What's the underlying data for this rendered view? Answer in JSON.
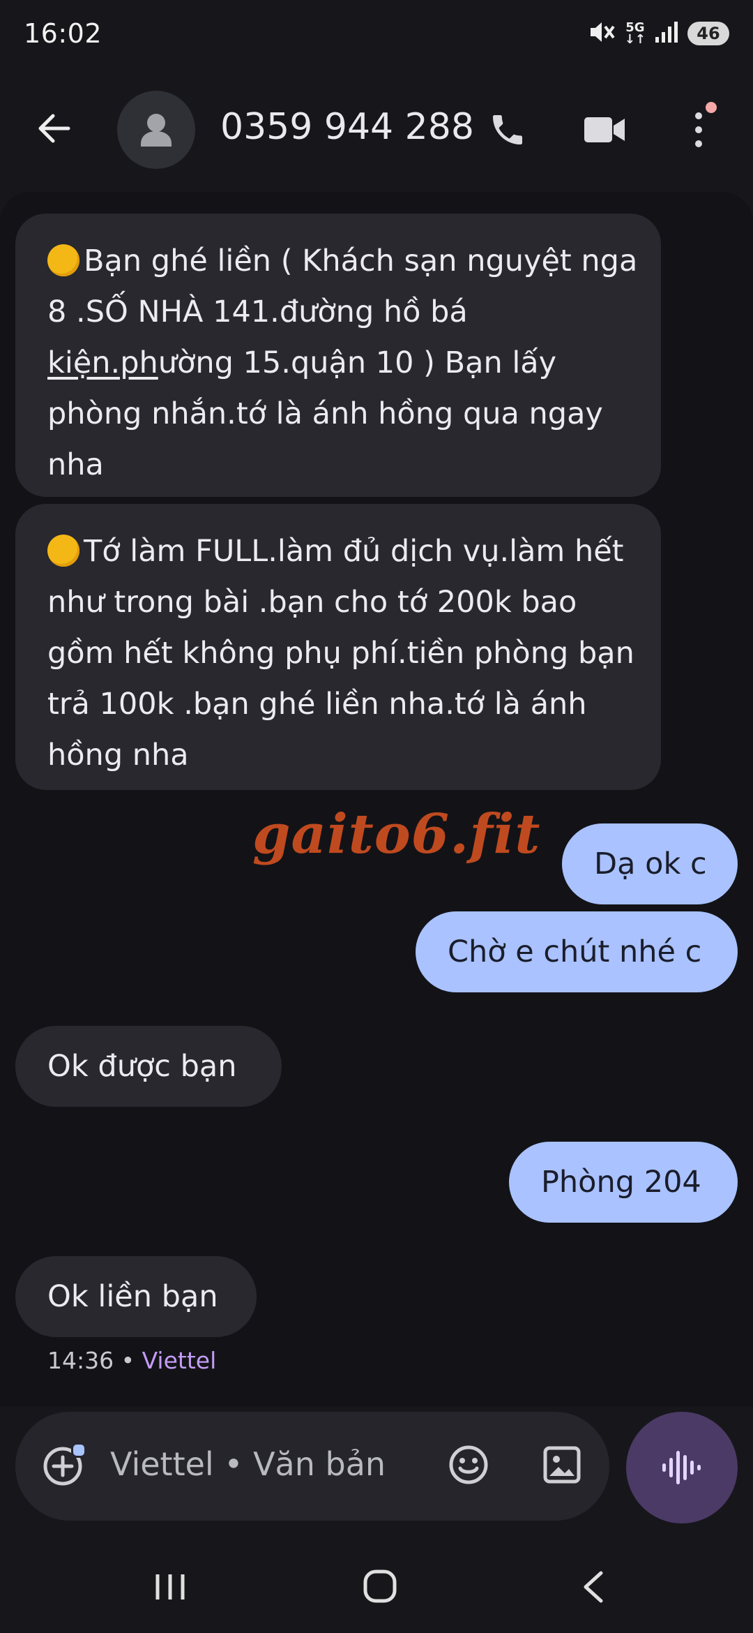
{
  "status_bar": {
    "time": "16:02",
    "network": "5G",
    "battery": "46",
    "icons": [
      "mute-icon",
      "5g-icon",
      "signal-icon",
      "battery-icon"
    ]
  },
  "header": {
    "contact": "0359 944 288",
    "icons": [
      "back-arrow-icon",
      "avatar-icon",
      "phone-icon",
      "video-icon",
      "more-vert-icon"
    ]
  },
  "messages": [
    {
      "direction": "incoming",
      "parts": [
        "Bạn  ghé liền ( Khách sạn nguyệt nga",
        "8 .SỐ NHÀ 141.đường hồ bá",
        "kiện.ph",
        "ường 15.quận 10 ) Bạn  lấy",
        "phòng nhắn.tớ là ánh hồng qua ngay",
        "nha"
      ]
    },
    {
      "direction": "incoming",
      "parts": [
        "Tớ làm FULL.làm đủ  dịch vụ.làm hết",
        "như trong bài .bạn cho tớ 200k bao",
        "gồm hết không phụ phí.tiền phòng bạn",
        "trả 100k  .bạn ghé liền nha.tớ là ánh",
        "hồng nha"
      ]
    },
    {
      "direction": "outgoing",
      "text": "Dạ ok c"
    },
    {
      "direction": "outgoing",
      "text": "Chờ e chút nhé c"
    },
    {
      "direction": "incoming",
      "text": "Ok được bạn"
    },
    {
      "direction": "outgoing",
      "text": "Phòng 204"
    },
    {
      "direction": "incoming",
      "text": "Ok liền bạn"
    }
  ],
  "watermark": "gaito6.fit",
  "last_meta": {
    "time": "14:36",
    "separator": " • ",
    "carrier": "Viettel"
  },
  "compose": {
    "placeholder": "Viettel • Văn bản"
  },
  "colors": {
    "incoming_bubble": "#28282e",
    "outgoing_bubble": "#aac2ff",
    "accent": "#c39cf5",
    "voice_button": "#4b3a66"
  }
}
